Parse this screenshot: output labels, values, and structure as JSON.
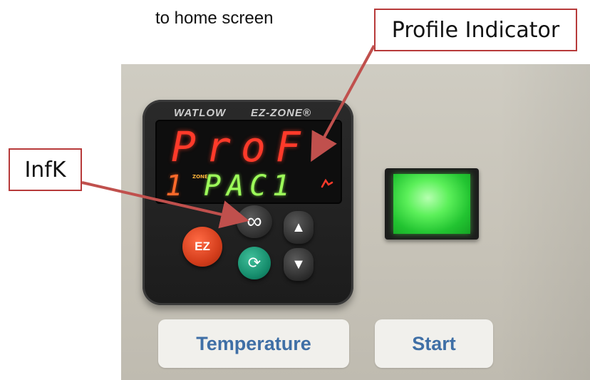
{
  "caption": "to home screen",
  "callouts": {
    "profile_indicator": "Profile Indicator",
    "infk": "InfK"
  },
  "controller": {
    "brand": "WATLOW",
    "model": "EZ-ZONE®",
    "upper_display": "ProF",
    "lower_display": "PAC1",
    "zone_number": "1",
    "zone_label": "ZONE",
    "buttons": {
      "ez": "EZ",
      "infinity": "∞",
      "cycle": "⟳",
      "up": "▲",
      "down": "▼"
    }
  },
  "labels": {
    "temperature": "Temperature",
    "start": "Start"
  },
  "colors": {
    "callout_border": "#b73a3a",
    "arrow": "#c0504d",
    "display_red": "#ff3a2a",
    "display_green": "#9dff5a",
    "start_light": "#5cf05a",
    "label_text": "#3f6fa6"
  }
}
